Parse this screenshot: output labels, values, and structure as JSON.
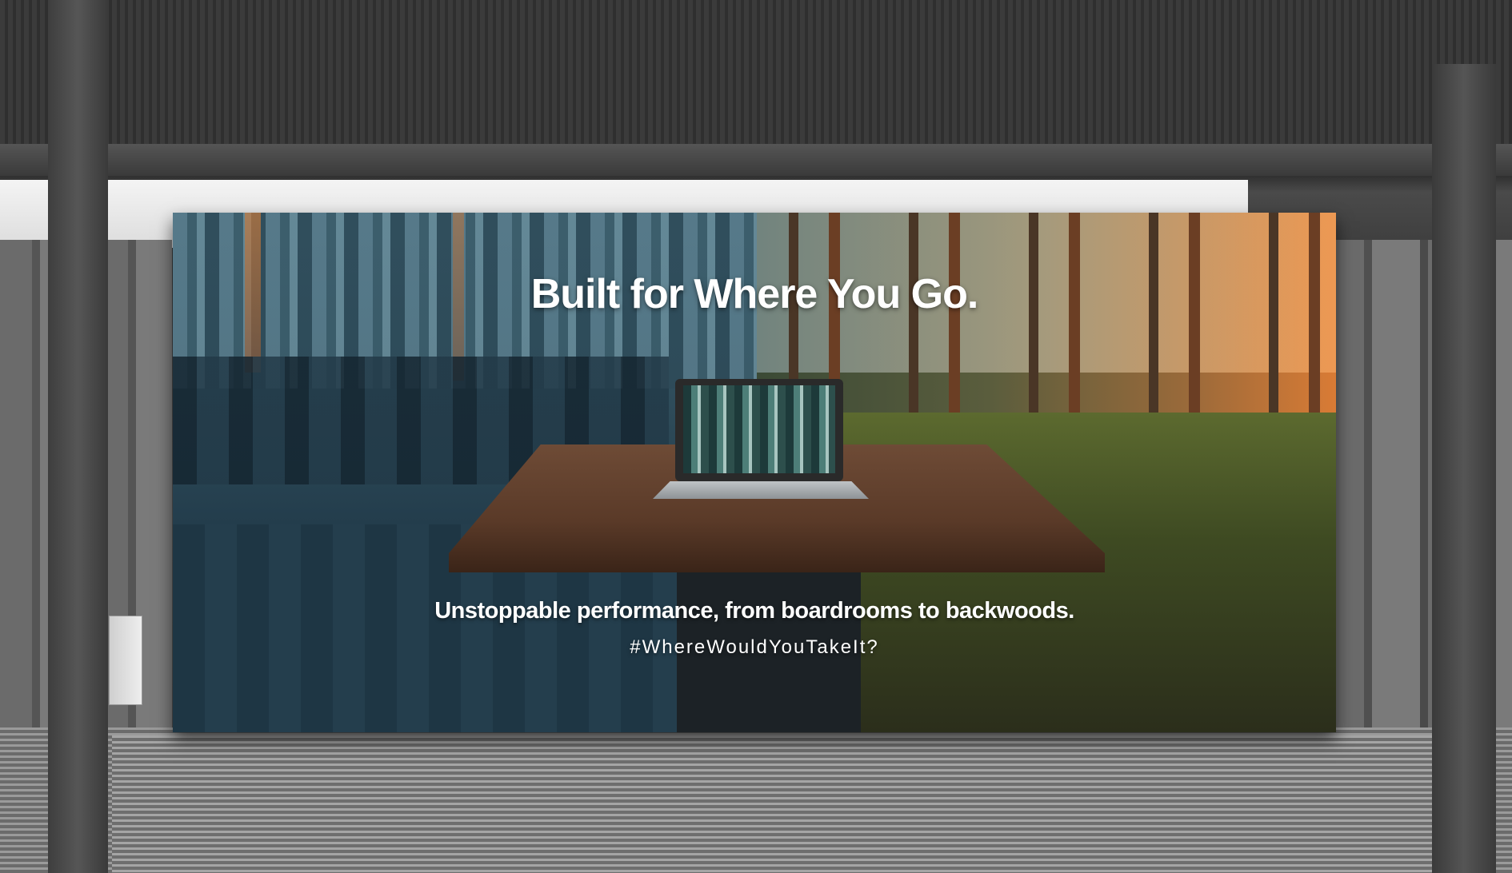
{
  "billboard": {
    "headline": "Built for Where You Go.",
    "tagline": "Unstoppable performance, from boardrooms to backwoods.",
    "hashtag": "#WhereWouldYouTakeIt?"
  },
  "colors": {
    "text": "#ffffff",
    "office_tone": "#2d4a58",
    "forest_tone": "#d97b35"
  }
}
